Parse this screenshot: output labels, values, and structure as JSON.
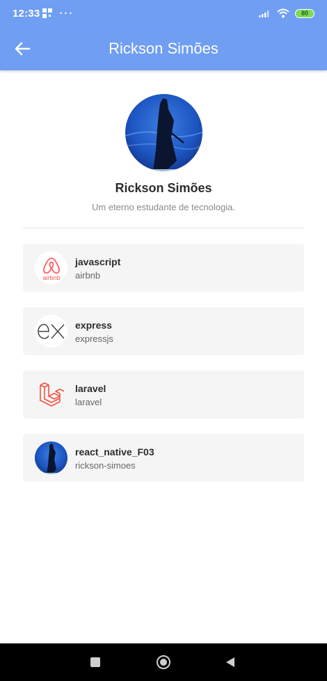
{
  "status_bar": {
    "time": "12:33",
    "dots": "···",
    "battery": "80",
    "icons": [
      "qr-icon",
      "signal-icon",
      "wifi-icon",
      "battery-icon"
    ]
  },
  "app_bar": {
    "title": "Rickson Simões",
    "back_icon": "arrow-left-icon"
  },
  "profile": {
    "name": "Rickson Simões",
    "bio": "Um eterno estudante de tecnologia."
  },
  "repositories": [
    {
      "name": "javascript",
      "owner": "airbnb",
      "logo": "airbnb-logo"
    },
    {
      "name": "express",
      "owner": "expressjs",
      "logo": "express-logo"
    },
    {
      "name": "laravel",
      "owner": "laravel",
      "logo": "laravel-logo"
    },
    {
      "name": "react_native_F03",
      "owner": "rickson-simoes",
      "logo": "user-avatar"
    }
  ],
  "colors": {
    "header": "#6f9ef3",
    "card": "#f5f5f5",
    "airbnb": "#ff5a5f",
    "laravel": "#f05340"
  },
  "nav_bar": {
    "icons": [
      "square-icon",
      "circle-home-icon",
      "triangle-back-icon"
    ]
  }
}
